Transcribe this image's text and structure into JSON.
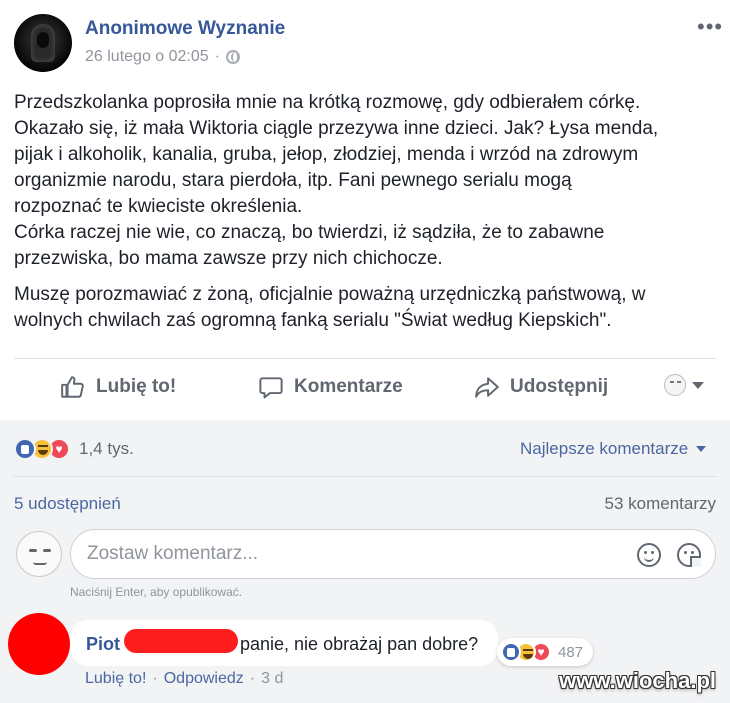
{
  "post": {
    "author": "Anonimowe Wyznanie",
    "timestamp": "26 lutego o 02:05",
    "separator": "·",
    "more_icon": "more-horizontal-icon",
    "paragraphs": [
      "Przedszkolanka poprosiła mnie na krótką rozmowę, gdy odbierałem córkę.\nOkazało się, iż mała Wiktoria ciągle przezywa inne dzieci. Jak? Łysa menda,\npijak i alkoholik, kanalia, gruba, jełop, złodziej, menda i wrzód na zdrowym\norganizmie narodu, stara pierdoła, itp. Fani pewnego serialu mogą\nrozpoznać te kwieciste określenia.\nCórka raczej nie wie, co znaczą, bo twierdzi, iż sądziła, że to zabawne\nprzezwiska, bo mama zawsze przy nich chichocze.",
      "Muszę porozmawiać z żoną, oficjalnie poważną urzędniczką państwową, w\nwolnych chwilach zaś ogromną fanką serialu \"Świat według Kiepskich\"."
    ]
  },
  "actions": {
    "like": "Lubię to!",
    "comment": "Komentarze",
    "share": "Udostępnij"
  },
  "stats": {
    "reactions_count": "1,4 tys.",
    "sort_label": "Najlepsze komentarze",
    "shares": "5 udostępnień",
    "comments": "53 komentarzy"
  },
  "composer": {
    "placeholder": "Zostaw komentarz...",
    "hint": "Naciśnij Enter, aby opublikować."
  },
  "comment": {
    "name": "Piot",
    "text": "panie, nie obrażaj pan dobre?",
    "reactions_count": "487",
    "like": "Lubię to!",
    "reply": "Odpowiedz",
    "separator": "·",
    "time": "3 d"
  },
  "watermark": "www.wiocha.pl",
  "colors": {
    "link": "#365899",
    "secondary_text": "#90949c",
    "footer_bg": "#f2f3f5",
    "like_blue": "#4267b2",
    "love_red": "#ed4956",
    "haha_yellow": "#f7c23a",
    "redaction_red": "#ff0000"
  }
}
